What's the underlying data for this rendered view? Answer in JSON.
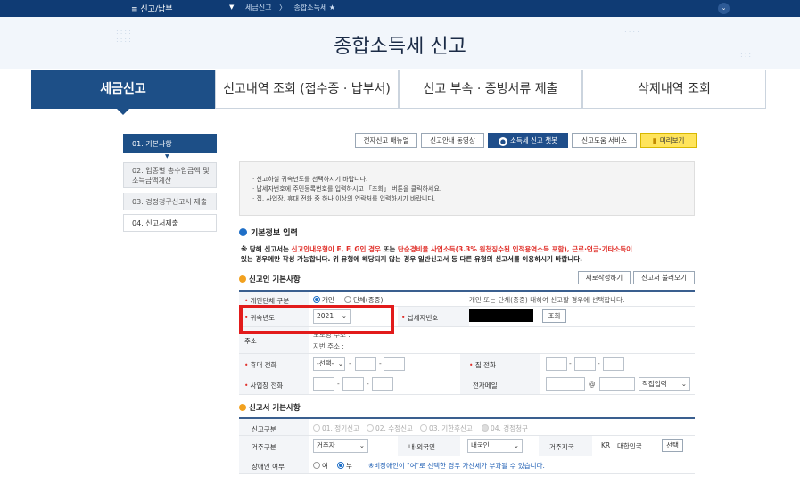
{
  "topbar": {
    "menu": "≡ 신고/납부",
    "crumb1": "세금신고",
    "crumb2": "종합소득세 ★"
  },
  "hero": {
    "title": "종합소득세 신고"
  },
  "tabs": [
    {
      "label": "세금신고",
      "active": true
    },
    {
      "label": "신고내역 조회 (접수증 · 납부서)"
    },
    {
      "label": "신고 부속 · 증빙서류 제출"
    },
    {
      "label": "삭제내역 조회"
    }
  ],
  "steps": [
    {
      "label": "01. 기본사항",
      "active": true
    },
    {
      "label": "02. 업종별 총수입금액 및 소득금액계산"
    },
    {
      "label": "03. 경정청구신고서 제출"
    },
    {
      "label": "04. 신고서제출"
    }
  ],
  "toolbar": {
    "manual": "전자신고 매뉴얼",
    "video": "신고안내 동영상",
    "chatbot": "소득세 신고 챗봇",
    "help": "신고도움 서비스",
    "preview": "미리보기"
  },
  "notice": [
    "· 신고하실 귀속년도를 선택하시기 바랍니다.",
    "· 납세자번호에 주민등록번호를 입력하시고 「조회」 버튼을 클릭하세요.",
    "· 집, 사업장, 휴대 전화 중 하나 이상의 연락처를 입력하시기 바랍니다."
  ],
  "basic_info": {
    "title": "기본정보 입력"
  },
  "warning": {
    "p1": "※ 당해 신고서는 ",
    "p2": "신고안내유형이 E, F, G인 경우",
    "p3": " 또는 ",
    "p4": "단순경비율 사업소득(3.3% 원천징수된 인적용역소득 포함), 근로·연금·기타소득이",
    "p5": "있는 경우에만 작성 가능합니다. 위 유형에 해당되지 않는 경우 일반신고서 등 다른 유형의 신고서를 이용하시기 바랍니다."
  },
  "filer": {
    "title": "신고인 기본사항",
    "new_btn": "새로작성하기",
    "load_btn": "신고서 불러오기",
    "type_label": "개인단체 구분",
    "type_individual": "개인",
    "type_group": "단체(종중)",
    "type_hint": "개인 또는 단체(종중) 대하여 신고할 경우에 선택합니다.",
    "year_label": "귀속년도",
    "year_value": "2021",
    "taxno_label": "납세자번호",
    "lookup_btn": "조회",
    "addr_label": "주소",
    "addr_road": "도로명 주소 :",
    "addr_lot": "지번 주소 :",
    "mobile_label": "휴대 전화",
    "mobile_select": "-선택-",
    "home_label": "집 전화",
    "biz_label": "사업장 전화",
    "email_label": "전자메일",
    "email_at": "@",
    "email_select": "직접입력"
  },
  "return_info": {
    "title": "신고서 기본사항",
    "kind_label": "신고구분",
    "kind_options": [
      "01. 정기신고",
      "02. 수정신고",
      "03. 기한후신고",
      "04. 경정청구"
    ],
    "res_label": "거주구분",
    "res_value": "거주자",
    "nat_label": "내·외국인",
    "nat_value": "내국인",
    "country_label": "거주지국",
    "country_code": "KR",
    "country_name": "대한민국",
    "country_btn": "선택",
    "disabled_label": "장애인 여부",
    "disabled_no": "여",
    "disabled_yes": "부",
    "disabled_note": "※비장애인이 \"여\"로 선택한 경우 가산세가 부과될 수 있습니다."
  }
}
